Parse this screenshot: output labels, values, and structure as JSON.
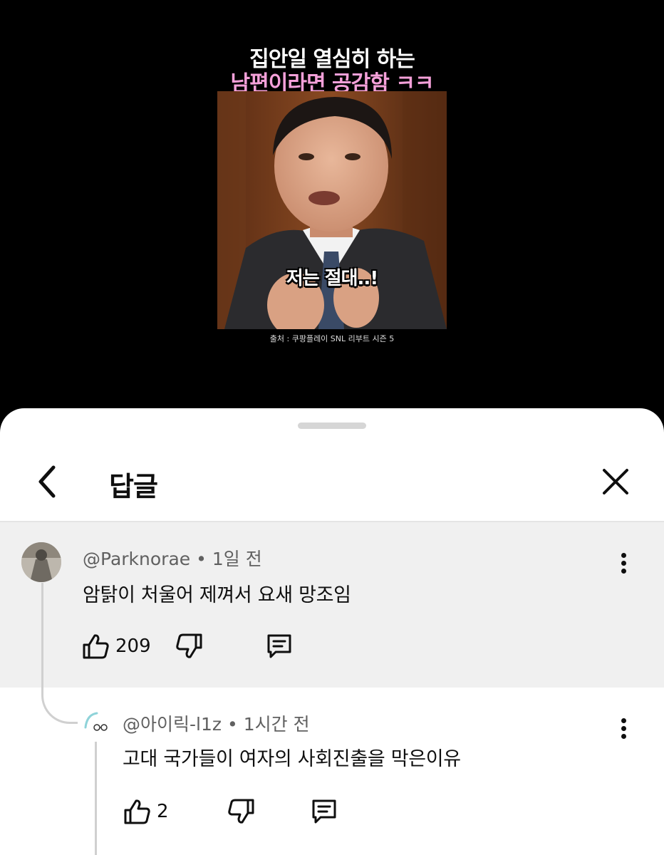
{
  "video": {
    "caption_line1": "집안일 열심히 하는",
    "caption_line2": "남편이라면 공감함 ㅋㅋ",
    "subtitle": "저는 절대..!",
    "source": "출처 : 쿠팡플레이 SNL 리부트 시즌 5"
  },
  "panel": {
    "title": "답글",
    "back_icon": "chevron-left-icon",
    "close_icon": "close-icon"
  },
  "comments": [
    {
      "author": "@Parknorae",
      "time": "1일 전",
      "text": "암탉이 처울어 제껴서 요새 망조임",
      "likes": "209"
    },
    {
      "author": "@아이릭-l1z",
      "time": "1시간 전",
      "text": "고대 국가들이 여자의 사회진출을 막은이유",
      "likes": "2"
    }
  ],
  "colors": {
    "caption_pink": "#f4a0d9",
    "highlight_bg": "#f0f0f0",
    "meta_gray": "#606060"
  }
}
